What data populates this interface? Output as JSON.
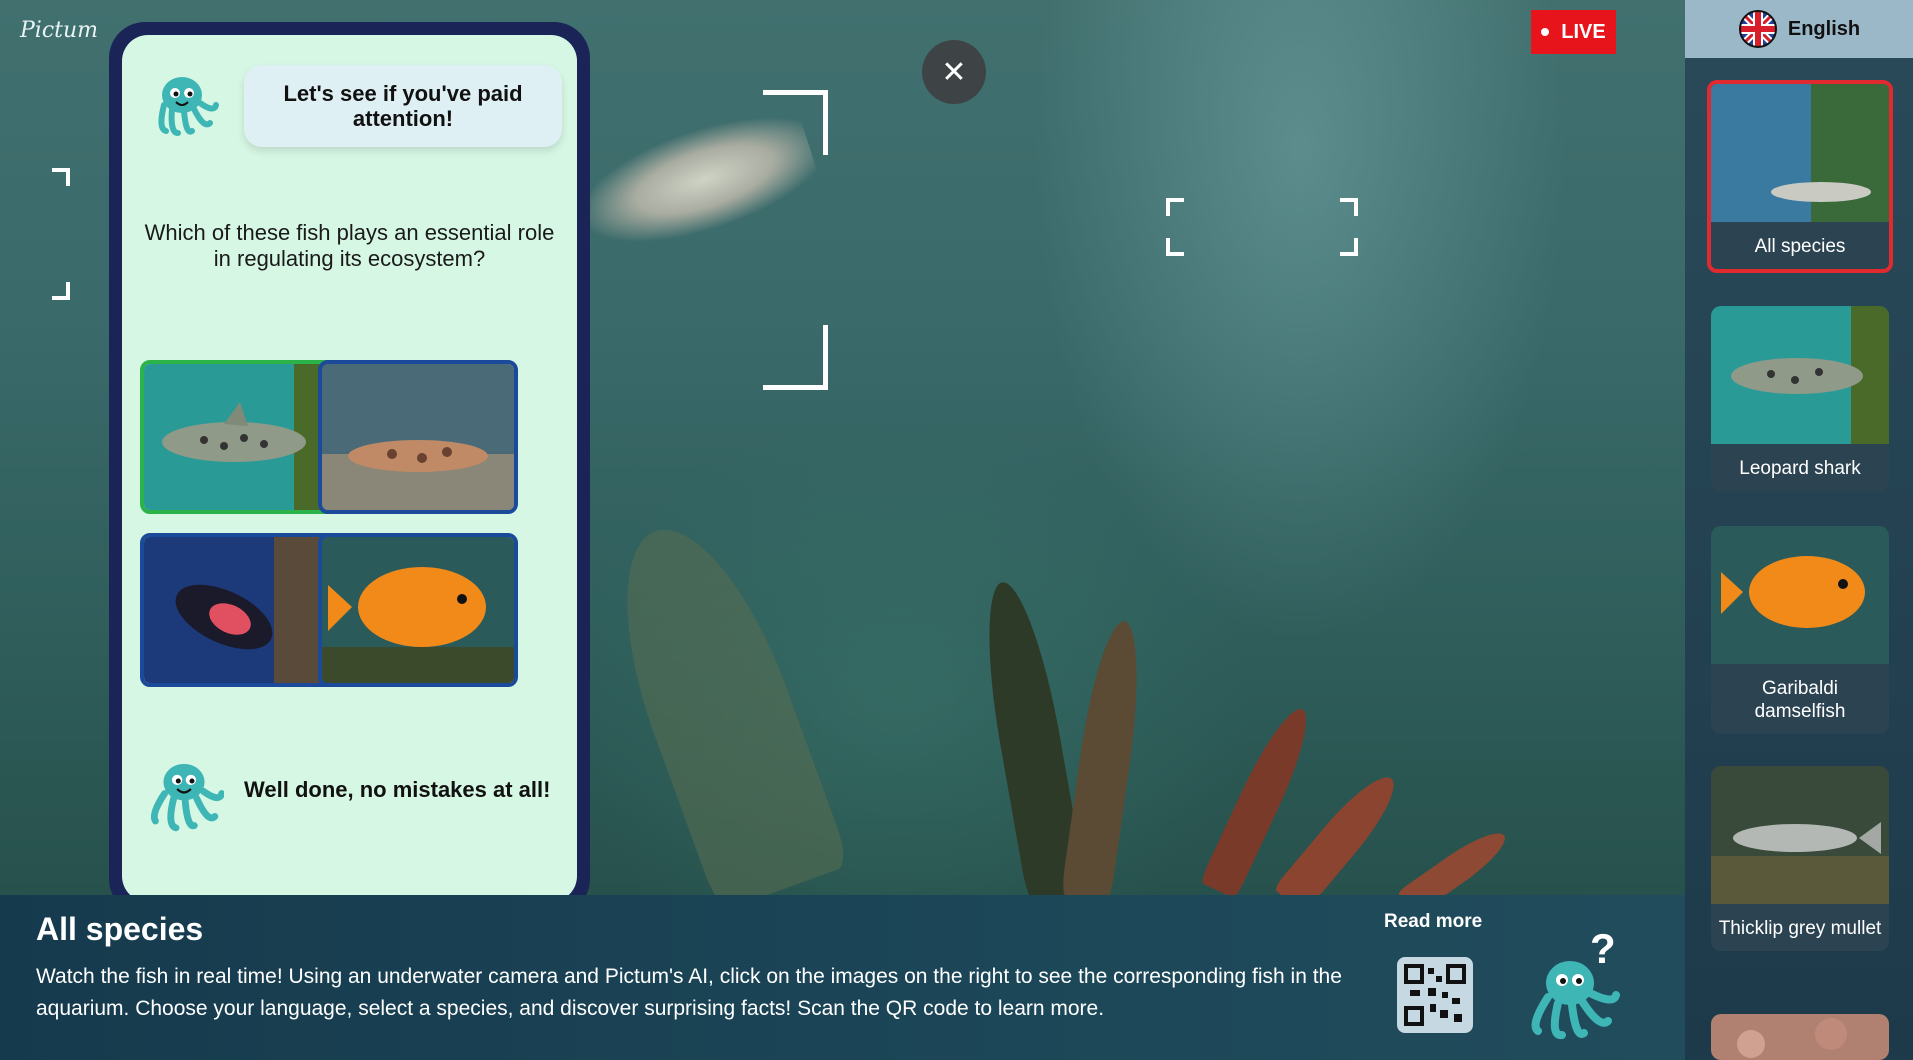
{
  "brand": "Pictum",
  "live_label": "LIVE",
  "close_symbol": "✕",
  "quiz": {
    "bubble_text": "Let's see if you've paid attention!",
    "question": "Which of these fish plays an essential role in regulating its ecosystem?",
    "options": [
      {
        "name": "leopard shark",
        "state": "correct"
      },
      {
        "name": "horn shark",
        "state": "default"
      },
      {
        "name": "sheephead",
        "state": "default"
      },
      {
        "name": "garibaldi damselfish",
        "state": "default"
      }
    ],
    "feedback": "Well done, no mistakes at all!"
  },
  "sidebar": {
    "language": "English",
    "items": [
      {
        "label": "All species"
      },
      {
        "label": "Leopard shark"
      },
      {
        "label": "Garibaldi damselfish"
      },
      {
        "label": "Thicklip grey mullet"
      }
    ]
  },
  "info": {
    "title": "All species",
    "description": "Watch the fish in real time! Using an underwater camera and Pictum's AI, click on the images on the right to see the corresponding fish in the aquarium. Choose your language, select a species, and discover surprising facts! Scan the QR code to learn more.",
    "read_more": "Read more"
  },
  "colors": {
    "live": "#e8141b",
    "quiz_frame": "#1a2457",
    "quiz_bg": "#d6f7e4",
    "correct_border": "#2bb349",
    "option_border": "#1c4a9a",
    "active_card_border": "#e02a30"
  },
  "icons": [
    "close-icon",
    "octopus-mascot-icon",
    "uk-flag-icon",
    "qr-code-icon",
    "octopus-question-icon"
  ]
}
